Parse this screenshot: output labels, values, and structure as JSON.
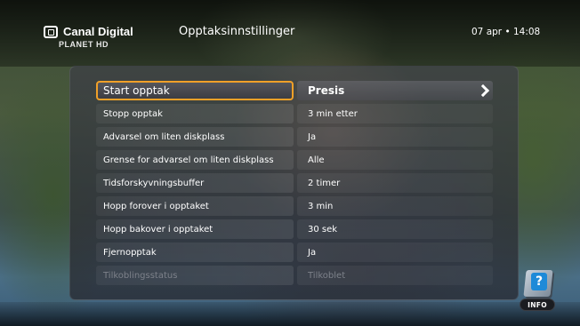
{
  "header": {
    "brand": "Canal Digital",
    "channel_logo": "PLANET HD",
    "title": "Opptaksinnstillinger",
    "datetime": "07 apr • 14:08"
  },
  "settings": [
    {
      "label": "Start opptak",
      "value": "Presis",
      "selected": true
    },
    {
      "label": "Stopp opptak",
      "value": "3 min etter"
    },
    {
      "label": "Advarsel om liten diskplass",
      "value": "Ja"
    },
    {
      "label": "Grense for advarsel om liten diskplass",
      "value": "Alle"
    },
    {
      "label": "Tidsforskyvningsbuffer",
      "value": "2 timer"
    },
    {
      "label": "Hopp forover i opptaket",
      "value": "3 min"
    },
    {
      "label": "Hopp bakover i opptaket",
      "value": "30 sek"
    },
    {
      "label": "Fjernopptak",
      "value": "Ja"
    },
    {
      "label": "Tilkoblingsstatus",
      "value": "Tilkoblet",
      "disabled": true
    }
  ],
  "info": {
    "question_mark": "?",
    "button_label": "INFO"
  },
  "colors": {
    "focus_border": "#f0a028",
    "disabled_text": "#7d818a",
    "info_icon": "#1e8ad8"
  },
  "icons": {
    "brand": "tv-icon",
    "selected_row": "chevron-right-icon",
    "info": "help-book-icon"
  }
}
